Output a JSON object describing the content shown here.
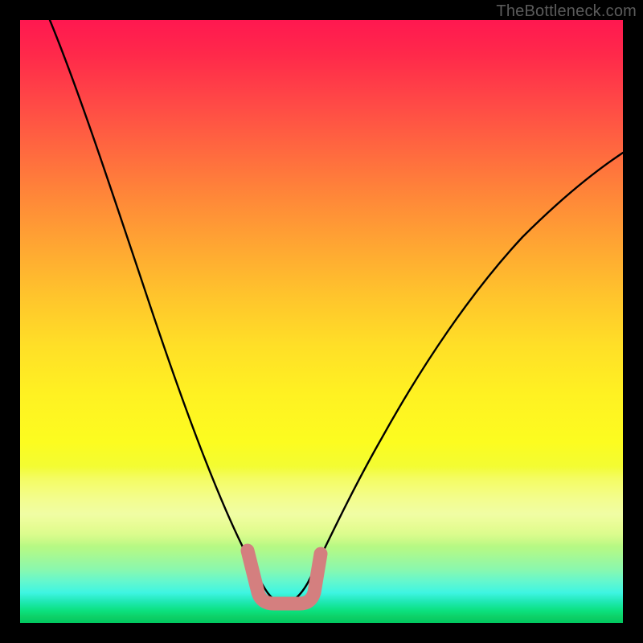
{
  "watermark": {
    "text": "TheBottleneck.com"
  },
  "chart_data": {
    "type": "line",
    "title": "",
    "xlabel": "",
    "ylabel": "",
    "xlim": [
      0,
      100
    ],
    "ylim": [
      0,
      100
    ],
    "grid": false,
    "legend": false,
    "background": "rainbow-vertical-gradient",
    "annotations": [
      {
        "name": "optimal-zone-marker",
        "shape": "rounded-u",
        "color": "#d47f7f",
        "x_range": [
          37,
          48
        ],
        "y_range": [
          5,
          13
        ]
      }
    ],
    "series": [
      {
        "name": "bottleneck-curve",
        "color": "#000000",
        "x": [
          5,
          8,
          12,
          16,
          20,
          24,
          28,
          32,
          35,
          38,
          40,
          42,
          44,
          46,
          48,
          51,
          55,
          60,
          66,
          73,
          81,
          90,
          100
        ],
        "y": [
          100,
          92,
          82,
          72,
          62,
          52,
          42,
          32,
          24,
          16,
          11,
          7,
          5,
          5,
          6,
          10,
          17,
          26,
          36,
          47,
          58,
          68,
          78
        ]
      }
    ]
  }
}
